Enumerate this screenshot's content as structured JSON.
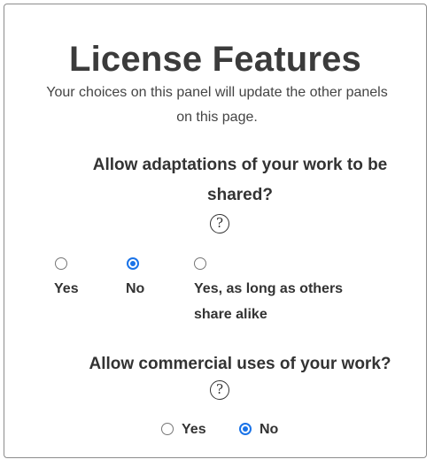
{
  "panel": {
    "title": "License Features",
    "subtitle": "Your choices on this panel will update the other panels on this page."
  },
  "adaptations": {
    "question": "Allow adaptations of your work to be shared?",
    "help_glyph": "?",
    "options": [
      {
        "label": "Yes",
        "selected": false
      },
      {
        "label": "No",
        "selected": true
      },
      {
        "label": "Yes, as long as others share alike",
        "selected": false
      }
    ]
  },
  "commercial": {
    "question": "Allow commercial uses of your work?",
    "help_glyph": "?",
    "options": [
      {
        "label": "Yes",
        "selected": false
      },
      {
        "label": "No",
        "selected": true
      }
    ]
  },
  "colors": {
    "accent": "#1a73e8",
    "text": "#333333",
    "border": "#8c8c8c"
  }
}
